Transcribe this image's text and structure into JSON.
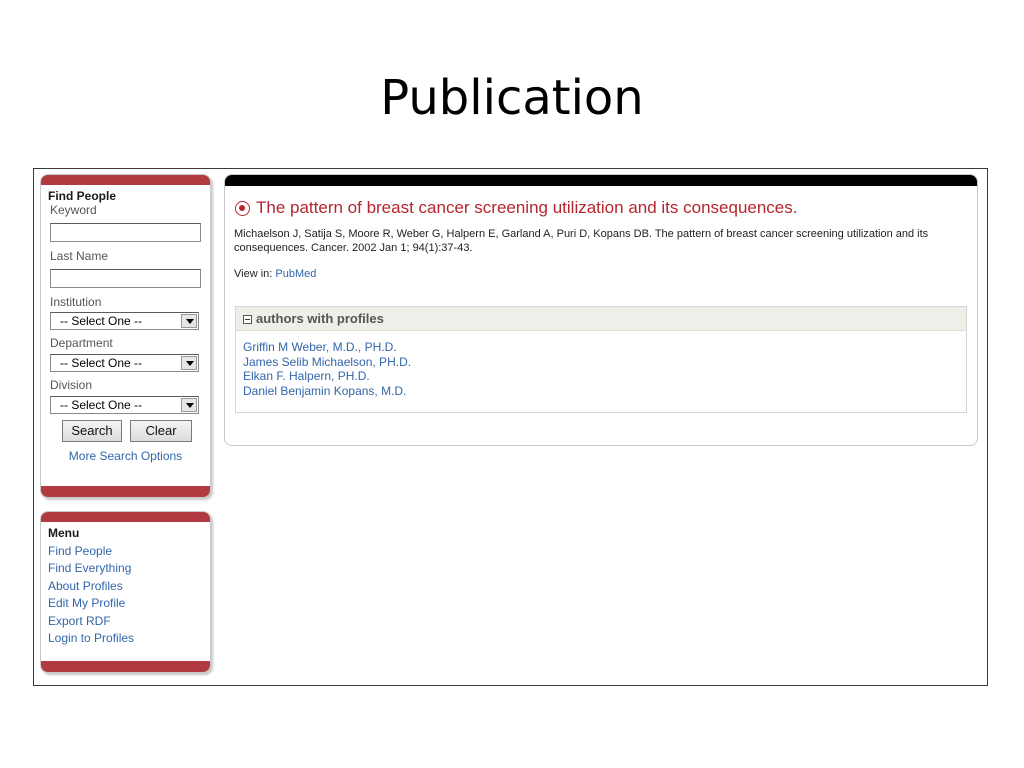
{
  "slide": {
    "title": "Publication"
  },
  "find_people": {
    "title": "Find People",
    "keyword_label": "Keyword",
    "keyword_value": "",
    "last_name_label": "Last Name",
    "last_name_value": "",
    "institution_label": "Institution",
    "institution_selected": "-- Select One --",
    "department_label": "Department",
    "department_selected": "-- Select One --",
    "division_label": "Division",
    "division_selected": "-- Select One --",
    "search_label": "Search",
    "clear_label": "Clear",
    "more_options_label": "More Search Options"
  },
  "menu": {
    "title": "Menu",
    "items": [
      {
        "label": "Find People"
      },
      {
        "label": "Find Everything"
      },
      {
        "label": "About Profiles"
      },
      {
        "label": "Edit My Profile"
      },
      {
        "label": "Export RDF"
      },
      {
        "label": "Login to Profiles"
      }
    ]
  },
  "publication": {
    "title": "The pattern of breast cancer screening utilization and its consequences.",
    "citation": "Michaelson J, Satija S, Moore R, Weber G, Halpern E, Garland A, Puri D, Kopans DB. The pattern of breast cancer screening utilization and its consequences. Cancer. 2002 Jan 1; 94(1):37-43.",
    "view_in_label": "View in:",
    "view_in_link": "PubMed"
  },
  "authors": {
    "title": "authors with profiles",
    "list": [
      {
        "name": "Griffin M Weber, M.D., PH.D."
      },
      {
        "name": "James Selib Michaelson, PH.D."
      },
      {
        "name": "Elkan F. Halpern, PH.D."
      },
      {
        "name": "Daniel Benjamin Kopans, M.D."
      }
    ]
  },
  "colors": {
    "accent_red": "#b03a40",
    "title_red": "#b5262f",
    "link_blue": "#3366aa",
    "header_black": "#000000"
  }
}
